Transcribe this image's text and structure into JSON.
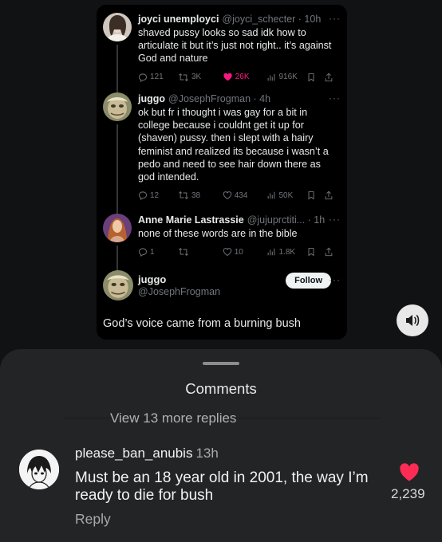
{
  "tweets": [
    {
      "name": "joyci unemployci",
      "meta": "@joyci_schecter · 10h",
      "text": "shaved pussy looks so sad idk how to articulate it but it’s just not right.. it’s against God and nature",
      "replies": "121",
      "retweets": "3K",
      "likes": "26K",
      "views": "916K"
    },
    {
      "name": "juggo",
      "meta": "@JosephFrogman · 4h",
      "text": "ok but fr i thought i was gay for a bit in college because i couldnt get it up for (shaven) pussy. then i slept with a hairy feminist and realized its because i wasn’t a pedo and need to see hair down there as god intended.",
      "replies": "12",
      "retweets": "38",
      "likes": "434",
      "views": "50K"
    },
    {
      "name": "Anne Marie Lastrassie",
      "meta": "@jujuprctiti... · 1h",
      "text": "none of these words are in the bible",
      "replies": "1",
      "retweets": "",
      "likes": "10",
      "views": "1.8K"
    }
  ],
  "main_tweet": {
    "name": "juggo",
    "handle": "@JosephFrogman",
    "follow_label": "Follow",
    "text": "God’s voice came from a burning bush"
  },
  "comments_panel": {
    "title": "Comments",
    "view_more": "View 13 more replies",
    "comment": {
      "username": "please_ban_anubis",
      "time": "13h",
      "text": "Must be an 18 year old in 2001, the way I’m ready to die for bush",
      "reply_label": "Reply",
      "likes": "2,239"
    }
  },
  "colors": {
    "like_pink": "#f91880",
    "heart_red": "#fe2c55",
    "muted": "#71767b"
  },
  "icons": [
    "reply-icon",
    "retweet-icon",
    "like-icon",
    "views-icon",
    "bookmark-icon",
    "share-icon",
    "more-icon",
    "sound-icon",
    "heart-icon"
  ]
}
